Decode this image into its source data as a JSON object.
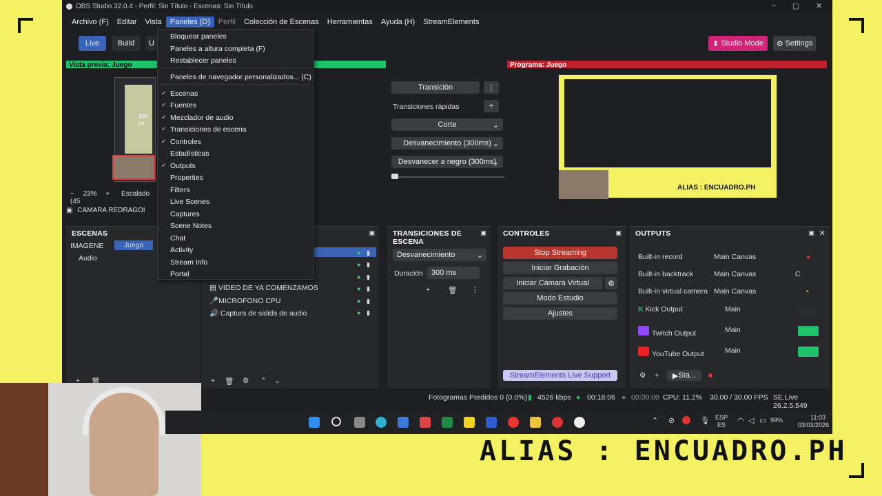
{
  "window": {
    "title": "OBS Studio 32.0.4 - Perfil: Sin Título - Escenas: Sin Título"
  },
  "menubar": [
    "Archivo (F)",
    "Editar",
    "Vista",
    "Paneles (D)",
    "Perfil",
    "Colección de Escenas",
    "Herramientas",
    "Ayuda (H)",
    "StreamElements"
  ],
  "toolbar": {
    "live": "Live",
    "build": "Build",
    "u": "U",
    "studio_mode": "Studio Mode",
    "settings": "Settings"
  },
  "preview": {
    "label": "Vista previa: Juego",
    "zoom": "23%",
    "scaling": "Escalado (45",
    "camera_source": "CAMARA REDRAGOI",
    "px_label": "835 px"
  },
  "program": {
    "label": "Programa: Juego",
    "overlay_text": "ALIAS : ENCUADRO.PH"
  },
  "transition_panel": {
    "transition": "Transición",
    "quick": "Transiciones rápidas",
    "corte": "Corte",
    "fade": "Desvanecimiento (300ms)",
    "fade_black": "Desvanecer a negro (300ms)"
  },
  "dropdown": {
    "items": [
      {
        "label": "Bloquear paneles",
        "checked": false
      },
      {
        "label": "Paneles a altura completa (F)",
        "checked": false
      },
      {
        "label": "Restablecer paneles",
        "checked": false
      },
      {
        "label": "Paneles de navegador personalizados... (C)",
        "checked": false
      },
      {
        "label": "Escenas",
        "checked": true
      },
      {
        "label": "Fuentes",
        "checked": true
      },
      {
        "label": "Mezclador de audio",
        "checked": true
      },
      {
        "label": "Transiciones de escena",
        "checked": true
      },
      {
        "label": "Controles",
        "checked": true
      },
      {
        "label": "Estadísticas",
        "checked": false
      },
      {
        "label": "Outputs",
        "checked": true
      },
      {
        "label": "Properties",
        "checked": false
      },
      {
        "label": "Filters",
        "checked": false
      },
      {
        "label": "Live Scenes",
        "checked": false
      },
      {
        "label": "Captures",
        "checked": false
      },
      {
        "label": "Scene Notes",
        "checked": false
      },
      {
        "label": "Chat",
        "checked": false
      },
      {
        "label": "Activity",
        "checked": false
      },
      {
        "label": "Stream Info",
        "checked": false
      },
      {
        "label": "Portal",
        "checked": false
      }
    ]
  },
  "scenes": {
    "title": "ESCENAS",
    "items": [
      "IMAGENE",
      "Juego",
      "Audio"
    ]
  },
  "sources": {
    "items": [
      "VIDEO DE YA COMENZAMOS",
      "MICROFONO CPU",
      "Captura de salida de audio"
    ]
  },
  "scene_transitions": {
    "title": "TRANSICIONES DE ESCENA",
    "selected": "Desvanecimiento",
    "duration_label": "Duración",
    "duration_value": "300 ms"
  },
  "controls": {
    "title": "CONTROLES",
    "stop_streaming": "Stop Streaming",
    "start_recording": "Iniciar Grabación",
    "virtual_cam": "Iniciar Cámara Virtual",
    "studio_mode": "Modo Estudio",
    "settings": "Ajustes",
    "support": "StreamElements Live Support"
  },
  "outputs": {
    "title": "OUTPUTS",
    "rows": [
      {
        "name": "Built-in record",
        "canvas": "Main Canvas"
      },
      {
        "name": "Built-in backtrack",
        "canvas": "Main Canvas"
      },
      {
        "name": "Built-in virtual camera",
        "canvas": "Main Canvas"
      },
      {
        "name": "Kick Output",
        "canvas": "Main"
      },
      {
        "name": "Twitch Output",
        "canvas": "Main"
      },
      {
        "name": "YouTube Output",
        "canvas": "Main"
      }
    ],
    "footer_btn": "Sta..."
  },
  "statusbar": {
    "dropped": "Fotogramas Perdidos 0 (0.0%)",
    "bitrate": "4526 kbps",
    "stream_time": "00:18:06",
    "rec_time": "00:00:00",
    "cpu": "CPU: 11.2%",
    "fps": "30.00 / 30.00 FPS",
    "version": "SE.Live 26.2.5.549"
  },
  "taskbar": {
    "lang1": "ESP",
    "lang2": "ES",
    "battery": "99%",
    "time": "11:03",
    "date": "03/03/2026"
  },
  "overlay": {
    "big_text": "ALIAS : ENCUADRO.PH"
  },
  "colors": {
    "accent_pink": "#d0247a",
    "live_blue": "#3a64b8",
    "stop_red": "#b7372f",
    "green": "#1ec26b"
  }
}
